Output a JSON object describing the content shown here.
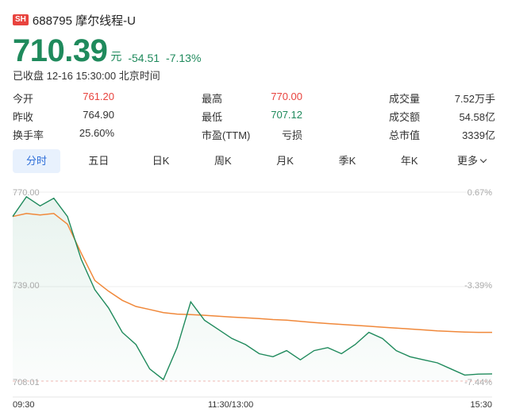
{
  "header": {
    "market_badge": "SH",
    "title": "688795 摩尔线程-U"
  },
  "quote": {
    "price": "710.39",
    "unit": "元",
    "change": "-54.51",
    "change_pct": "-7.13%",
    "status": "已收盘 12-16 15:30:00 北京时间"
  },
  "stats": [
    [
      {
        "label": "今开",
        "value": "761.20",
        "color": "red"
      },
      {
        "label": "最高",
        "value": "770.00",
        "color": "red"
      },
      {
        "label": "成交量",
        "value": "7.52万手",
        "color": "normal"
      }
    ],
    [
      {
        "label": "昨收",
        "value": "764.90",
        "color": "normal"
      },
      {
        "label": "最低",
        "value": "707.12",
        "color": "green"
      },
      {
        "label": "成交额",
        "value": "54.58亿",
        "color": "normal"
      }
    ],
    [
      {
        "label": "换手率",
        "value": "25.60%",
        "color": "normal"
      },
      {
        "label": "市盈(TTM)",
        "value": "亏损",
        "color": "normal"
      },
      {
        "label": "总市值",
        "value": "3339亿",
        "color": "normal"
      }
    ]
  ],
  "tabs": [
    {
      "label": "分时",
      "active": true
    },
    {
      "label": "五日",
      "active": false
    },
    {
      "label": "日K",
      "active": false
    },
    {
      "label": "周K",
      "active": false
    },
    {
      "label": "月K",
      "active": false
    },
    {
      "label": "季K",
      "active": false
    },
    {
      "label": "年K",
      "active": false
    },
    {
      "label": "更多",
      "active": false,
      "icon": "chevron-down-icon"
    }
  ],
  "chart_data": {
    "type": "line",
    "title": "",
    "y_labels_left": [
      "770.00",
      "739.00",
      "708.01"
    ],
    "y_labels_right": [
      "0.67%",
      "-3.39%",
      "-7.44%"
    ],
    "x_labels": [
      "09:30",
      "11:30/13:00",
      "15:30"
    ],
    "ylim": [
      708.01,
      770.0
    ],
    "reference_price": 764.9,
    "x": [
      "09:30",
      "09:33",
      "09:36",
      "09:39",
      "09:42",
      "09:45",
      "09:50",
      "09:55",
      "10:00",
      "10:05",
      "10:10",
      "10:15",
      "10:20",
      "10:25",
      "10:30",
      "10:40",
      "10:50",
      "11:00",
      "11:10",
      "11:20",
      "11:30",
      "13:10",
      "13:20",
      "13:30",
      "13:40",
      "13:50",
      "14:00",
      "14:10",
      "14:20",
      "14:30",
      "14:40",
      "14:50",
      "15:00",
      "15:10",
      "15:20",
      "15:30"
    ],
    "series": [
      {
        "values": [
          762.0,
          768.5,
          765.5,
          768.0,
          762.0,
          748.0,
          738.0,
          732.0,
          724.0,
          720.0,
          712.0,
          708.5,
          719.0,
          734.0,
          728.0,
          725.0,
          722.0,
          720.0,
          717.0,
          716.0,
          718.0,
          715.0,
          718.0,
          719.0,
          717.0,
          720.0,
          724.0,
          722.0,
          718.0,
          716.0,
          715.0,
          714.0,
          712.0,
          710.0,
          710.3,
          710.39
        ],
        "line_color": "#1f8a5c"
      },
      {
        "values": [
          762.0,
          763.0,
          762.5,
          763.0,
          759.5,
          750.0,
          741.0,
          737.5,
          734.5,
          732.5,
          731.5,
          730.5,
          730.0,
          729.8,
          729.6,
          729.3,
          729.0,
          728.8,
          728.5,
          728.2,
          728.0,
          727.6,
          727.2,
          726.9,
          726.6,
          726.3,
          726.0,
          725.7,
          725.4,
          725.1,
          724.8,
          724.5,
          724.3,
          724.1,
          724.0,
          724.0
        ],
        "line_color": "#f0883a"
      }
    ]
  },
  "colors": {
    "up": "#e8433e",
    "down": "#1f8a5c",
    "accent": "#2f6fd9",
    "avg_line": "#f0883a"
  }
}
